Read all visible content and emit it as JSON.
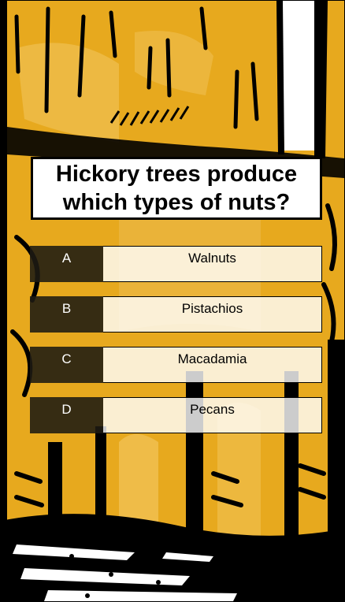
{
  "colors": {
    "background_yellow": "#E7A91E",
    "ink": "#000000",
    "letter_cell": "#1E1A12",
    "answer_cell": "#FFFFFF"
  },
  "question": {
    "text": "Hickory trees produce which types of nuts?"
  },
  "answers": [
    {
      "letter": "A",
      "text": "Walnuts"
    },
    {
      "letter": "B",
      "text": "Pistachios"
    },
    {
      "letter": "C",
      "text": "Macadamia"
    },
    {
      "letter": "D",
      "text": "Pecans"
    }
  ]
}
